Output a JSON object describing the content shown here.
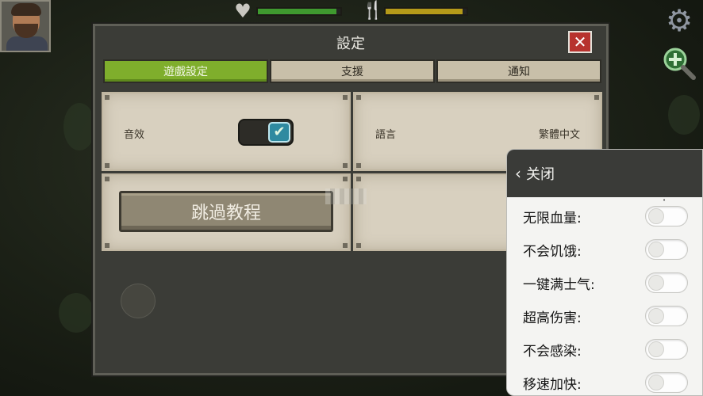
{
  "hud": {
    "health_icon": "heart-icon",
    "hunger_icon": "fork-knife-icon",
    "health_level": 0.95,
    "hunger_level": 0.95,
    "health_color": "#3f9a2f",
    "hunger_color": "#b59a19"
  },
  "settings": {
    "title": "設定",
    "close_label": "✕",
    "tabs": [
      {
        "label": "遊戲設定",
        "active": true
      },
      {
        "label": "支援",
        "active": false
      },
      {
        "label": "通知",
        "active": false
      }
    ],
    "sound_label": "音效",
    "sound_enabled": true,
    "language_label": "語言",
    "language_value": "繁體中文",
    "skip_tutorial_label": "跳過教程"
  },
  "cheat_menu": {
    "back_label": "关闭",
    "items": [
      {
        "label": "无限血量:",
        "enabled": false
      },
      {
        "label": "不会饥饿:",
        "enabled": false
      },
      {
        "label": "一键满士气:",
        "enabled": false
      },
      {
        "label": "超高伤害:",
        "enabled": false
      },
      {
        "label": "不会感染:",
        "enabled": false
      },
      {
        "label": "移速加快:",
        "enabled": false
      }
    ]
  },
  "colors": {
    "active_tab": "#7fae2c",
    "close_button": "#b7322e",
    "toggle_check": "#2f8aa0"
  }
}
